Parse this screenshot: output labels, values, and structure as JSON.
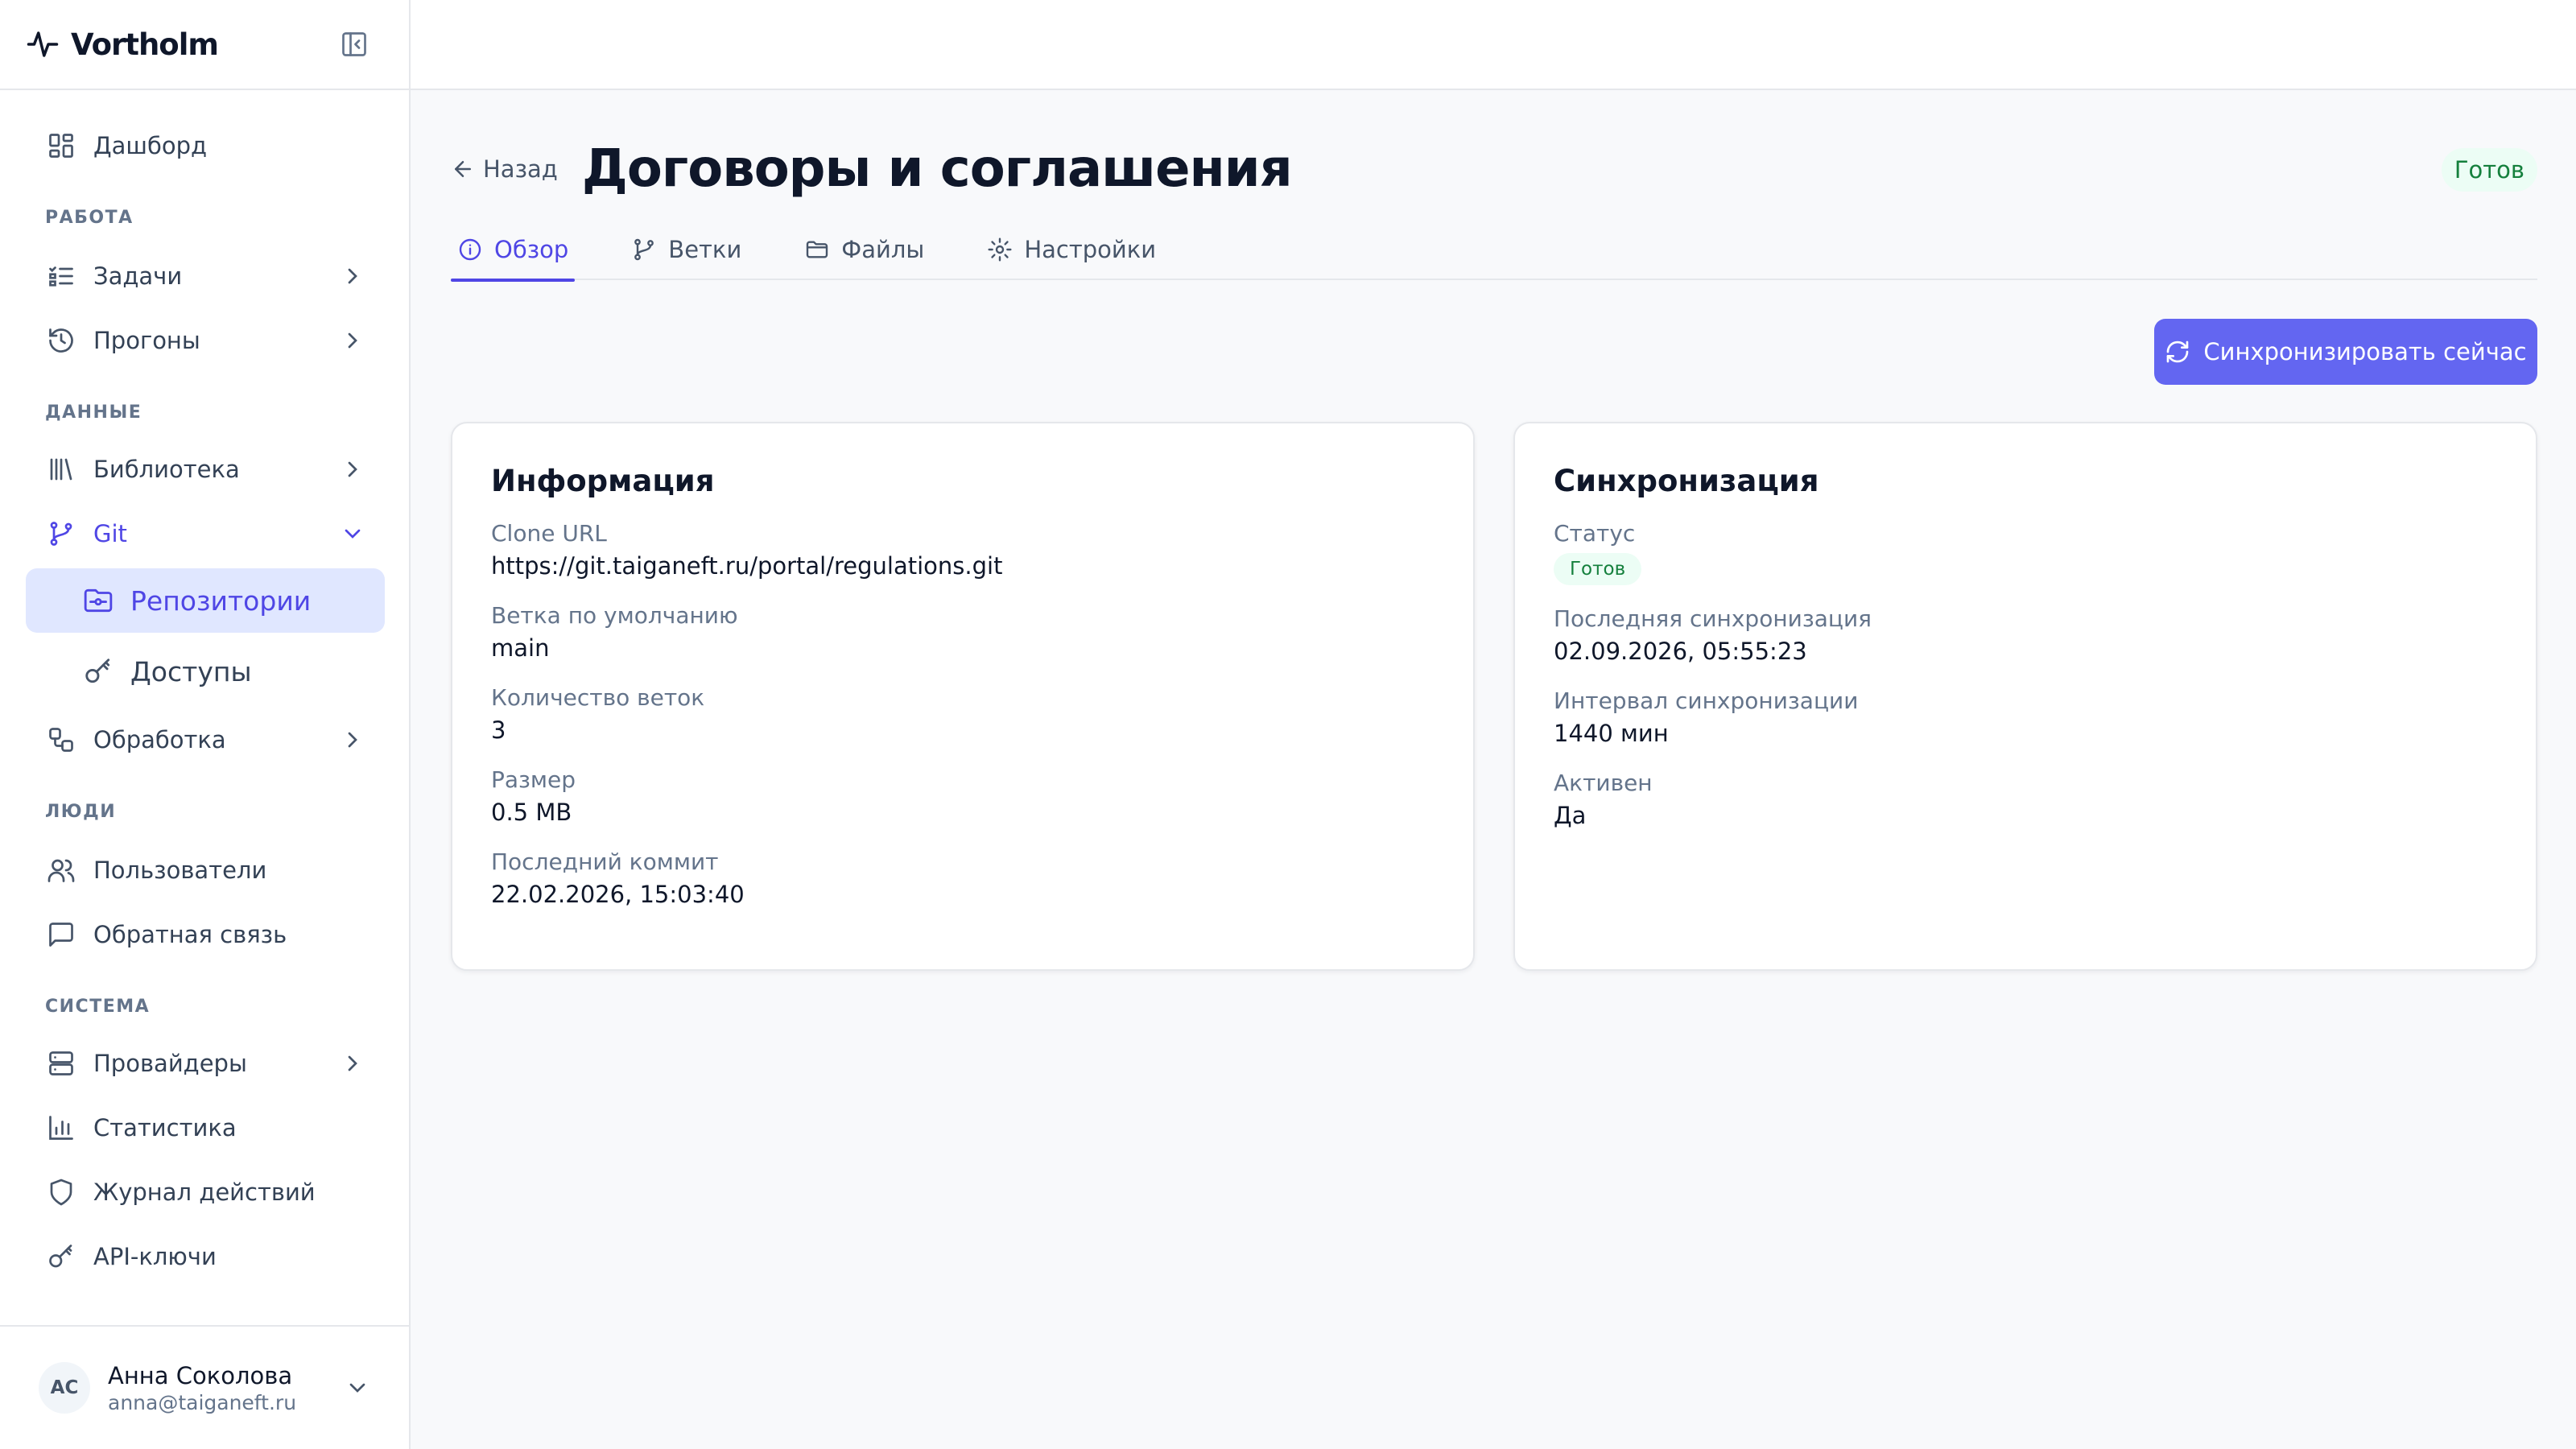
{
  "app": {
    "name": "Vortholm"
  },
  "sidebar": {
    "dashboard": "Дашборд",
    "sections": {
      "work": "РАБОТА",
      "data": "ДАННЫЕ",
      "people": "ЛЮДИ",
      "system": "СИСТЕМА"
    },
    "items": {
      "tasks": "Задачи",
      "runs": "Прогоны",
      "library": "Библиотека",
      "git": "Git",
      "repos": "Репозитории",
      "access": "Доступы",
      "processing": "Обработка",
      "users": "Пользователи",
      "feedback": "Обратная связь",
      "providers": "Провайдеры",
      "stats": "Статистика",
      "audit": "Журнал действий",
      "apikeys": "API-ключи"
    },
    "user": {
      "initials": "АС",
      "name": "Анна Соколова",
      "email": "anna@taiganeft.ru"
    }
  },
  "header": {
    "back": "Назад",
    "title": "Договоры и соглашения",
    "status": "Готов"
  },
  "tabs": [
    {
      "label": "Обзор",
      "icon": "info-icon"
    },
    {
      "label": "Ветки",
      "icon": "branch-icon"
    },
    {
      "label": "Файлы",
      "icon": "folder-icon"
    },
    {
      "label": "Настройки",
      "icon": "gear-icon"
    }
  ],
  "actions": {
    "sync_now": "Синхронизировать сейчас"
  },
  "info": {
    "title": "Информация",
    "clone_url_label": "Clone URL",
    "clone_url": "https://git.taiganeft.ru/portal/regulations.git",
    "default_branch_label": "Ветка по умолчанию",
    "default_branch": "main",
    "branch_count_label": "Количество веток",
    "branch_count": "3",
    "size_label": "Размер",
    "size": "0.5 MB",
    "last_commit_label": "Последний коммит",
    "last_commit": "22.02.2026, 15:03:40"
  },
  "sync": {
    "title": "Синхронизация",
    "status_label": "Статус",
    "status": "Готов",
    "last_sync_label": "Последняя синхронизация",
    "last_sync": "02.09.2026, 05:55:23",
    "interval_label": "Интервал синхронизации",
    "interval": "1440 мин",
    "active_label": "Активен",
    "active": "Да"
  },
  "colors": {
    "accent": "#4f46e5",
    "button": "#6366f1",
    "success_text": "#15803d",
    "success_bg": "#ecfdf5"
  }
}
